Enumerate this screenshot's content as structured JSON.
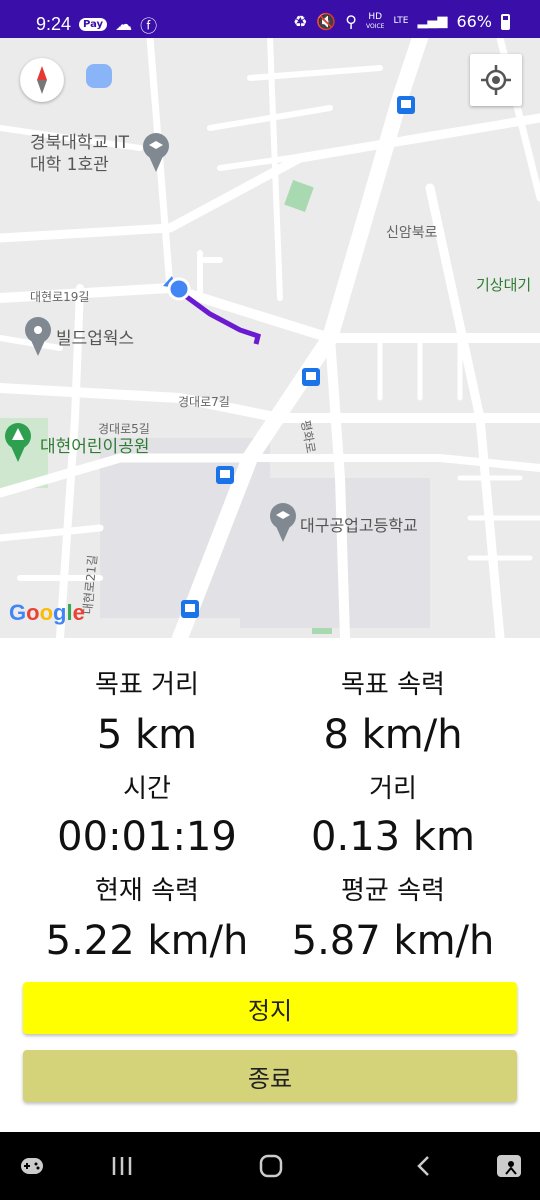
{
  "status_bar": {
    "time": "9:24",
    "pay_badge": "Pay",
    "hd_top": "HD",
    "hd_bottom": "VOICE",
    "lte": "LTE",
    "battery": "66%"
  },
  "map": {
    "labels": {
      "univ": "경북대학교 IT\n대학 1호관",
      "street_19": "대현로19길",
      "build": "빌드업웍스",
      "sinam": "신암북로",
      "gisang": "기상대기",
      "gyeongdae7": "경대로7길",
      "gyeongdae5": "경대로5길",
      "park": "대현어린이공원",
      "school": "대구공업고등학교",
      "pyeonghwa": "평화로",
      "street_21": "대현로21길",
      "google": "Google"
    },
    "route_color": "#6a1bd1",
    "marker_color": "#4285f4"
  },
  "stats": {
    "target_distance": {
      "label": "목표 거리",
      "value": "5 km"
    },
    "target_speed": {
      "label": "목표 속력",
      "value": "8 km/h"
    },
    "time": {
      "label": "시간",
      "value": "00:01:19"
    },
    "distance": {
      "label": "거리",
      "value": "0.13 km"
    },
    "current_speed": {
      "label": "현재 속력",
      "value": "5.22 km/h"
    },
    "avg_speed": {
      "label": "평균 속력",
      "value": "5.87 km/h"
    }
  },
  "buttons": {
    "stop": "정지",
    "end": "종료"
  },
  "colors": {
    "status_bar": "#3a0ea8",
    "stop_button": "#ffff00",
    "end_button": "#d4d37a"
  },
  "nav_icons": [
    "gamepad-icon",
    "recent-apps-icon",
    "home-icon",
    "back-icon",
    "accessibility-icon"
  ]
}
